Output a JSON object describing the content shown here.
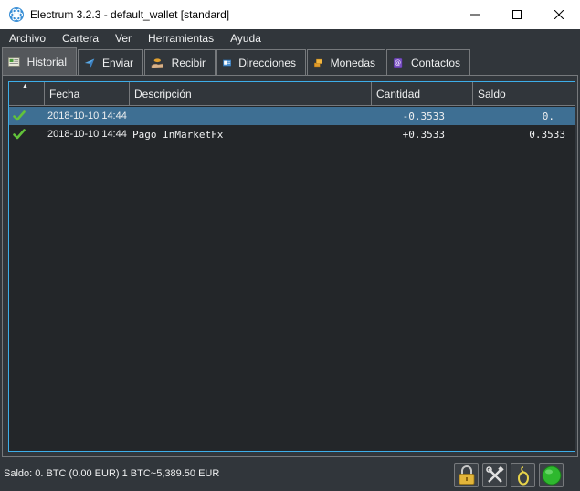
{
  "window": {
    "title": "Electrum 3.2.3  -  default_wallet  [standard]",
    "minimize_glyph": "—",
    "maximize_glyph": "☐",
    "close_glyph": "✕"
  },
  "menu": [
    {
      "label": "Archivo"
    },
    {
      "label": "Cartera"
    },
    {
      "label": "Ver"
    },
    {
      "label": "Herramientas"
    },
    {
      "label": "Ayuda"
    }
  ],
  "tabs": [
    {
      "label": "Historial",
      "icon": "history-icon",
      "active": true
    },
    {
      "label": "Enviar",
      "icon": "send-icon",
      "active": false
    },
    {
      "label": "Recibir",
      "icon": "receive-icon",
      "active": false
    },
    {
      "label": "Direcciones",
      "icon": "addresses-icon",
      "active": false
    },
    {
      "label": "Monedas",
      "icon": "coins-icon",
      "active": false
    },
    {
      "label": "Contactos",
      "icon": "contacts-icon",
      "active": false
    }
  ],
  "history": {
    "columns": [
      "",
      "Fecha",
      "Descripción",
      "Cantidad",
      "Saldo"
    ],
    "rows": [
      {
        "status": "confirmed",
        "date": "2018-10-10 14:44",
        "description": "",
        "amount": "-0.3533",
        "balance": "0."
      },
      {
        "status": "confirmed",
        "date": "2018-10-10 14:44",
        "description": "Pago InMarketFx",
        "amount": "+0.3533",
        "balance": "0.3533"
      }
    ]
  },
  "status": {
    "text": "Saldo: 0. BTC (0.00 EUR)  1 BTC~5,389.50 EUR"
  },
  "colors": {
    "background": "#31363b",
    "table_background": "#232629",
    "selection": "#3e6f93",
    "focus_border": "#3daee9",
    "check": "#62c33a",
    "network_ok": "#2eb82e"
  }
}
